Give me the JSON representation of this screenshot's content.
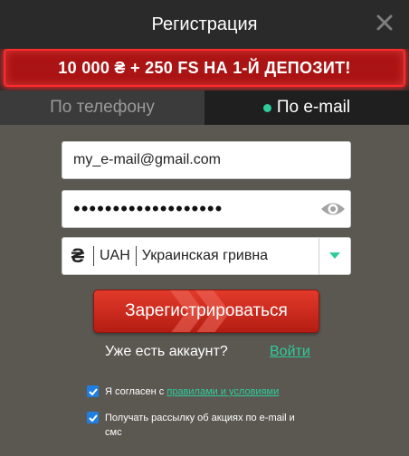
{
  "header": {
    "title": "Регистрация"
  },
  "banner": {
    "text": "10 000 ₴ + 250 FS НА 1-Й ДЕПОЗИТ!"
  },
  "tabs": [
    {
      "label": "По телефону",
      "active": false
    },
    {
      "label": "По e-mail",
      "active": true
    }
  ],
  "form": {
    "email_value": "my_e-mail@gmail.com",
    "password_value": "password12345678901",
    "currency": {
      "symbol": "₴",
      "code": "UAH",
      "name": "Украинская гривна"
    }
  },
  "register": {
    "label": "Зарегистрироваться"
  },
  "login": {
    "prompt": "Уже есть аккаунт?",
    "link": "Войти"
  },
  "agreements": {
    "terms_prefix": "Я согласен с ",
    "terms_link": "правилами и условиями",
    "newsletter_line1": "Получать рассылку об акциях по e-mail и",
    "newsletter_line2": "смс"
  },
  "colors": {
    "accent": "#2ecc9a",
    "banner_red": "#ab1414",
    "button_red": "#d32f20"
  }
}
